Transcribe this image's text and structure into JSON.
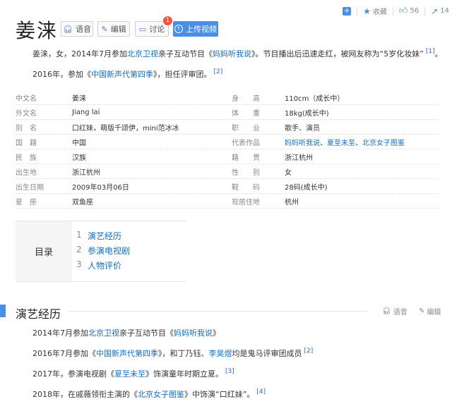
{
  "topbar": {
    "favorite": "收藏",
    "likes": "56",
    "shares": "14"
  },
  "title": "姜涞",
  "buttons": {
    "voice": "语音",
    "edit": "编辑",
    "discuss": "讨论",
    "discuss_badge": "1",
    "upload": "上传视频"
  },
  "intro": {
    "p1_a": "姜涞，女，2014年7月参加",
    "p1_link1": "北京卫视",
    "p1_b": "亲子互动节目《",
    "p1_link2": "妈妈听我说",
    "p1_c": "》。节目播出后迅速走红，被网友称为“5岁化妆妹”",
    "p1_ref": "[1]",
    "p1_d": "。",
    "p2_a": "2016年，参加《",
    "p2_link": "中国新声代第四季",
    "p2_b": "》，担任评审团。",
    "p2_ref": "[2]"
  },
  "info_rows": [
    {
      "k1": "中文名",
      "v1": "姜涞",
      "k2": "身　　高",
      "v2": "110cm（成长中）"
    },
    {
      "k1": "外文名",
      "v1": "Jiang lai",
      "k2": "体　　重",
      "v2": "18kg(成长中)"
    },
    {
      "k1": "别　名",
      "v1": "口红妹，萌版千颂伊，mini范冰冰",
      "k2": "职　　业",
      "v2": "歌手、演员"
    },
    {
      "k1": "国　籍",
      "v1": "中国",
      "k2": "代表作品",
      "v2": "妈妈听我说、夏至未至、北京女子图鉴"
    },
    {
      "k1": "民　族",
      "v1": "汉族",
      "k2": "籍　　贯",
      "v2": "浙江杭州"
    },
    {
      "k1": "出生地",
      "v1": "浙江杭州",
      "k2": "性　　别",
      "v2": "女"
    },
    {
      "k1": "出生日期",
      "v1": "2009年03月06日",
      "k2": "鞋　　码",
      "v2": "28码(成长中)"
    },
    {
      "k1": "星　座",
      "v1": "双鱼座",
      "k2": "现居住地",
      "v2": "杭州"
    }
  ],
  "toc": {
    "label": "目录",
    "items": [
      {
        "n": "1",
        "t": "演艺经历"
      },
      {
        "n": "2",
        "t": "参演电视剧"
      },
      {
        "n": "3",
        "t": "人物评价"
      }
    ]
  },
  "section": {
    "title": "演艺经历",
    "voice": "语音",
    "edit": "编辑",
    "l1_a": "2014年7月参加",
    "l1_link1": "北京卫视",
    "l1_b": "亲子互动节目《",
    "l1_link2": "妈妈听我说",
    "l1_c": "》",
    "l2_a": "2016年7月参加《",
    "l2_link1": "中国新声代第四季",
    "l2_b": "》，和丁乃钰、",
    "l2_link2": "李昊煜",
    "l2_c": "均是鬼马评审团成员",
    "l2_ref": "[2]",
    "l3_a": "2017年，参演电视剧《",
    "l3_link": "夏至未至",
    "l3_b": "》饰演童年时期立夏。",
    "l3_ref": "[3]",
    "l4_a": "2018年，在戚薇领衔主演的《",
    "l4_link": "北京女子图鉴",
    "l4_b": "》中饰演“口红妹”。",
    "l4_ref": "[4]"
  },
  "colors": {
    "link": "#136ec2",
    "accent": "#4a8fe7",
    "badge": "#f2553a"
  }
}
